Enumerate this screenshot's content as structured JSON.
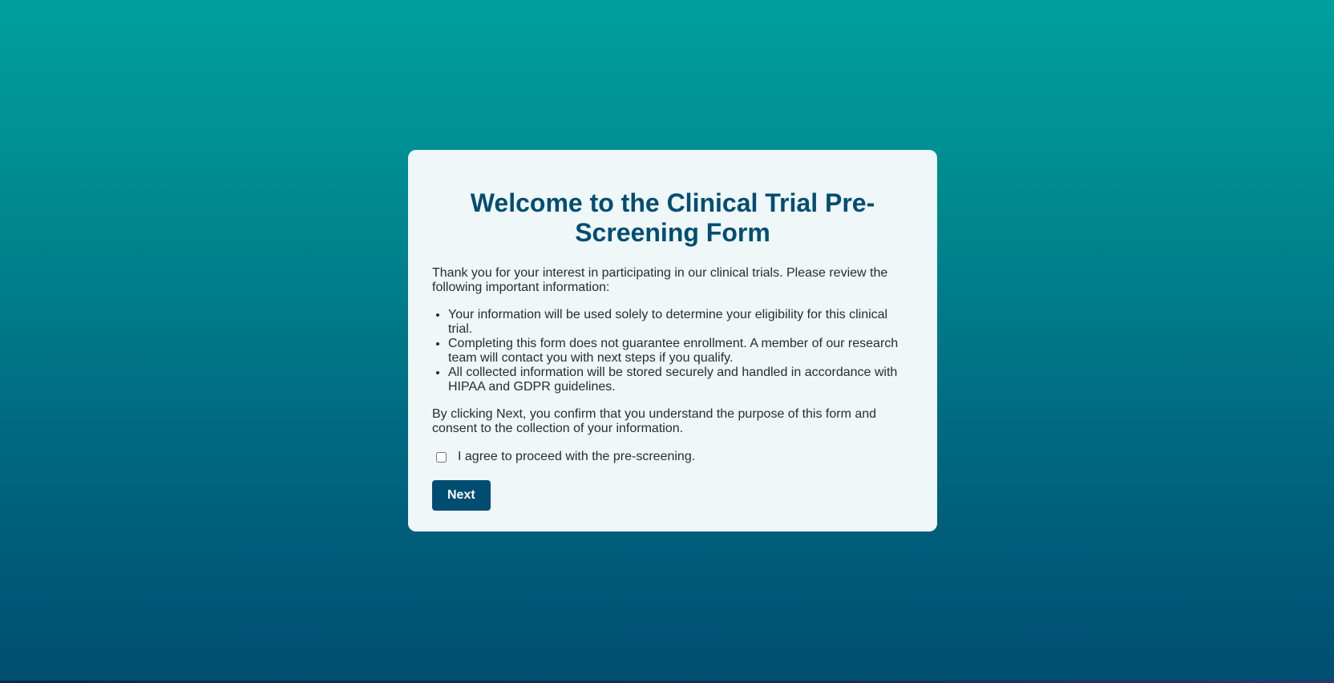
{
  "form": {
    "title": "Welcome to the Clinical Trial Pre-Screening Form",
    "intro": "Thank you for your interest in participating in our clinical trials. Please review the following important information:",
    "info_items": [
      "Your information will be used solely to determine your eligibility for this clinical trial.",
      "Completing this form does not guarantee enrollment. A member of our research team will contact you with next steps if you qualify.",
      "All collected information will be stored securely and handled in accordance with HIPAA and GDPR guidelines."
    ],
    "consent_text": "By clicking Next, you confirm that you understand the purpose of this form and consent to the collection of your information.",
    "agree_label": "I agree to proceed with the pre-screening.",
    "agree_checked": false,
    "next_label": "Next"
  },
  "colors": {
    "accent": "#004d72",
    "card_background": "#eff7f8",
    "text": "#2b2b2b",
    "background_top": "#009f9f",
    "background_bottom": "#004d70"
  }
}
